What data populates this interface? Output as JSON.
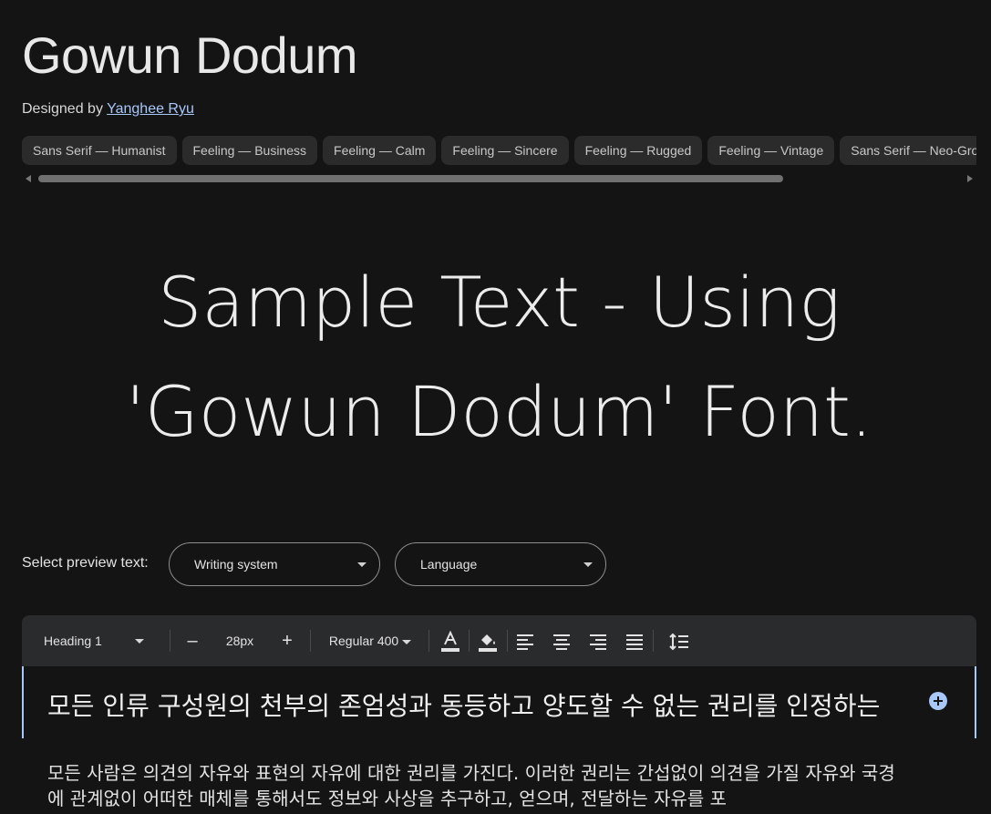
{
  "font": {
    "name": "Gowun Dodum",
    "designed_by_prefix": "Designed by",
    "designer": "Yanghee Ryu"
  },
  "tags": [
    "Sans Serif — Humanist",
    "Feeling — Business",
    "Feeling — Calm",
    "Feeling — Sincere",
    "Feeling — Rugged",
    "Feeling — Vintage",
    "Sans Serif — Neo-Grotesque"
  ],
  "sample_text": "Sample Text - Using 'Gowun Dodum' Font.",
  "preview": {
    "label": "Select preview text:",
    "writing_system": "Writing system",
    "language": "Language"
  },
  "toolbar": {
    "style": "Heading 1",
    "decrease": "–",
    "size": "28px",
    "increase": "+",
    "weight": "Regular 400",
    "text_color_icon": "text-color-icon",
    "highlight_icon": "highlight-icon",
    "align_left_icon": "align-left-icon",
    "align_center_icon": "align-center-icon",
    "align_right_icon": "align-right-icon",
    "align_justify_icon": "align-justify-icon",
    "line_height_icon": "line-height-icon"
  },
  "editor": {
    "heading": "모든 인류 구성원의 천부의 존엄성과 동등하고 양도할 수 없는 권리를 인정하는",
    "paragraph": "모든 사람은 의견의 자유와 표현의 자유에 대한 권리를 가진다. 이러한 권리는 간섭없이 의견을 가질 자유와 국경에 관계없이 어떠한 매체를 통해서도 정보와 사상을 추구하고, 얻으며, 전달하는 자유를 포"
  },
  "colors": {
    "background": "#141414",
    "accent": "#a8c7fa",
    "chip": "#2b2b2b",
    "toolbar": "#2a2b2c"
  }
}
